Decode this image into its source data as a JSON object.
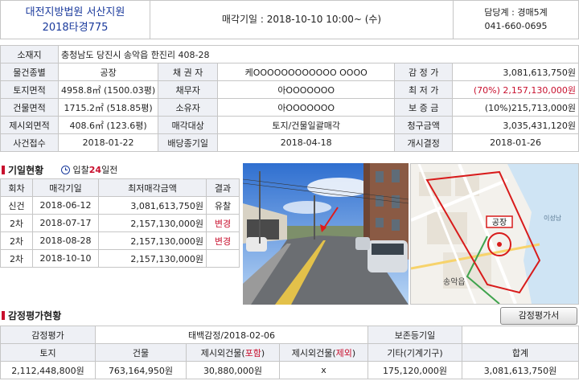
{
  "header": {
    "court": "대전지방법원 서산지원",
    "case_no": "2018타경775",
    "auction_date": "매각기일 : 2018-10-10   10:00~ (수)",
    "manager": "담당계 : 경매5계",
    "phone": "041-660-0695"
  },
  "info": {
    "address_label": "소재지",
    "address": "충청남도 당진시 송악읍 한진리 408-28",
    "rows": [
      [
        "물건종별",
        "공장",
        "채 권 자",
        "케OOOOOOOOOOOO OOOO",
        "감 정 가",
        "3,081,613,750원"
      ],
      [
        "토지면적",
        "4958.8㎡ (1500.03평)",
        "채무자",
        "아OOOOOOO",
        "최 저 가",
        "(70%) 2,157,130,000원"
      ],
      [
        "건물면적",
        "1715.2㎡ (518.85평)",
        "소유자",
        "아OOOOOOO",
        "보 증 금",
        "(10%)215,713,000원"
      ],
      [
        "제시외면적",
        "408.6㎡ (123.6평)",
        "매각대상",
        "토지/건물일괄매각",
        "청구금액",
        "3,035,431,120원"
      ],
      [
        "사건접수",
        "2018-01-22",
        "배당종기일",
        "2018-04-18",
        "개시결정",
        "2018-01-26"
      ]
    ]
  },
  "history": {
    "title": "기일현황",
    "badge_pre": "입찰",
    "badge_num": "24",
    "badge_post": "일전",
    "headers": [
      "회차",
      "매각기일",
      "최저매각금액",
      "결과"
    ],
    "rows": [
      [
        "신건",
        "2018-06-12",
        "3,081,613,750원",
        "유찰"
      ],
      [
        "2차",
        "2018-07-17",
        "2,157,130,000원",
        "변경"
      ],
      [
        "2차",
        "2018-08-28",
        "2,157,130,000원",
        "변경"
      ],
      [
        "2차",
        "2018-10-10",
        "2,157,130,000원",
        ""
      ]
    ]
  },
  "map": {
    "label": "공장",
    "texts": [
      "송악읍",
      "이성남"
    ]
  },
  "appraisal": {
    "title": "감정평가현황",
    "button": "감정평가서",
    "row1": [
      "감정평가",
      "태백감정/2018-02-06",
      "보존등기일",
      ""
    ],
    "headers": [
      "토지",
      "건물",
      "제시외건물(",
      "포함",
      ")",
      "제시외건물(",
      "제외",
      ")",
      "기타(기계기구)",
      "합계"
    ],
    "values": [
      "2,112,448,800원",
      "763,164,950원",
      "30,880,000원",
      "x",
      "175,120,000원",
      "3,081,613,750원"
    ]
  },
  "colors": {
    "accent": "#c8102e",
    "brand": "#1a3a9c",
    "label_bg": "#eef0f5"
  }
}
